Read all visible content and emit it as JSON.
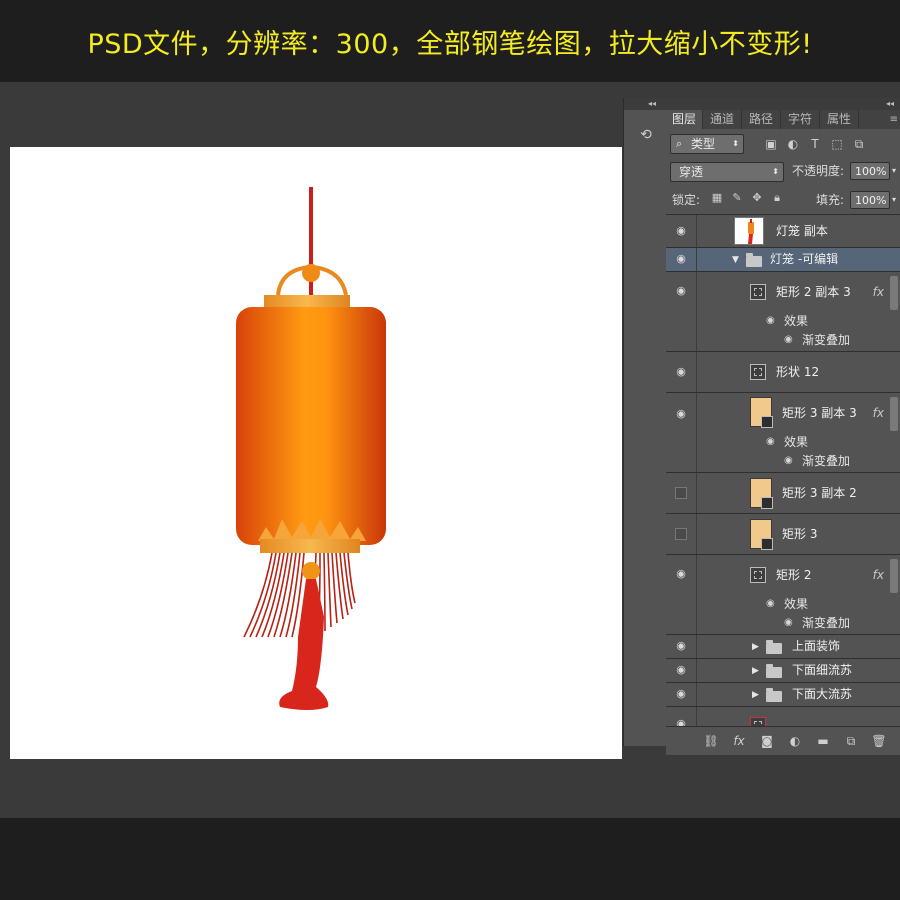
{
  "banner": {
    "text": "PSD文件，分辨率：300，全部钢笔绘图，拉大缩小不变形!"
  },
  "side_strip": {
    "history_icon": "history-icon"
  },
  "panel": {
    "collapse_left": "◂◂",
    "collapse_right": "◂◂",
    "tabs": [
      {
        "label": "图层",
        "active": true
      },
      {
        "label": "通道"
      },
      {
        "label": "路径"
      },
      {
        "label": "字符"
      },
      {
        "label": "属性"
      }
    ],
    "menu_icon": "≡",
    "filter": {
      "kind_label": "类型",
      "icons": [
        "image-filter-icon",
        "adjustment-filter-icon",
        "type-filter-icon",
        "shape-filter-icon",
        "smart-object-filter-icon"
      ]
    },
    "blend": {
      "mode": "穿透",
      "opacity_label": "不透明度:",
      "opacity_value": "100%"
    },
    "lock": {
      "label": "锁定:",
      "fill_label": "填充:",
      "fill_value": "100%"
    },
    "layers": [
      {
        "name": "灯笼 副本",
        "visible": true,
        "thumb": "image"
      },
      {
        "name": "灯笼 -可编辑",
        "visible": true,
        "thumb": "folder",
        "expanded": true,
        "selected": true
      },
      {
        "name": "矩形 2 副本 3",
        "visible": true,
        "thumb": "shape",
        "fx": "fx",
        "effects_label": "效果",
        "effect": "渐变叠加"
      },
      {
        "name": "形状 12",
        "visible": true,
        "thumb": "shape"
      },
      {
        "name": "矩形 3 副本 3",
        "visible": true,
        "thumb": "rect",
        "fx": "fx",
        "effects_label": "效果",
        "effect": "渐变叠加"
      },
      {
        "name": "矩形 3 副本 2",
        "visible": false,
        "thumb": "rect"
      },
      {
        "name": "矩形 3",
        "visible": false,
        "thumb": "rect"
      },
      {
        "name": "矩形 2",
        "visible": true,
        "thumb": "shape",
        "fx": "fx",
        "effects_label": "效果",
        "effect": "渐变叠加"
      },
      {
        "name": "上面装饰",
        "visible": true,
        "thumb": "folder"
      },
      {
        "name": "下面细流苏",
        "visible": true,
        "thumb": "folder"
      },
      {
        "name": "下面大流苏",
        "visible": true,
        "thumb": "folder"
      }
    ],
    "footer_icons": [
      "link-layers-icon",
      "fx-icon",
      "add-mask-icon",
      "adjustment-layer-icon",
      "new-group-icon",
      "new-layer-icon",
      "delete-layer-icon"
    ]
  },
  "colors": {
    "banner_text": "#f4ec21",
    "workspace": "#3a3a3a",
    "panel": "#535353",
    "selected_layer": "#566578",
    "lantern_body_dark": "#d8420a",
    "lantern_body_light": "#ff9a12",
    "lantern_gold": "#f2a43a",
    "tassel_red": "#d9261c"
  }
}
